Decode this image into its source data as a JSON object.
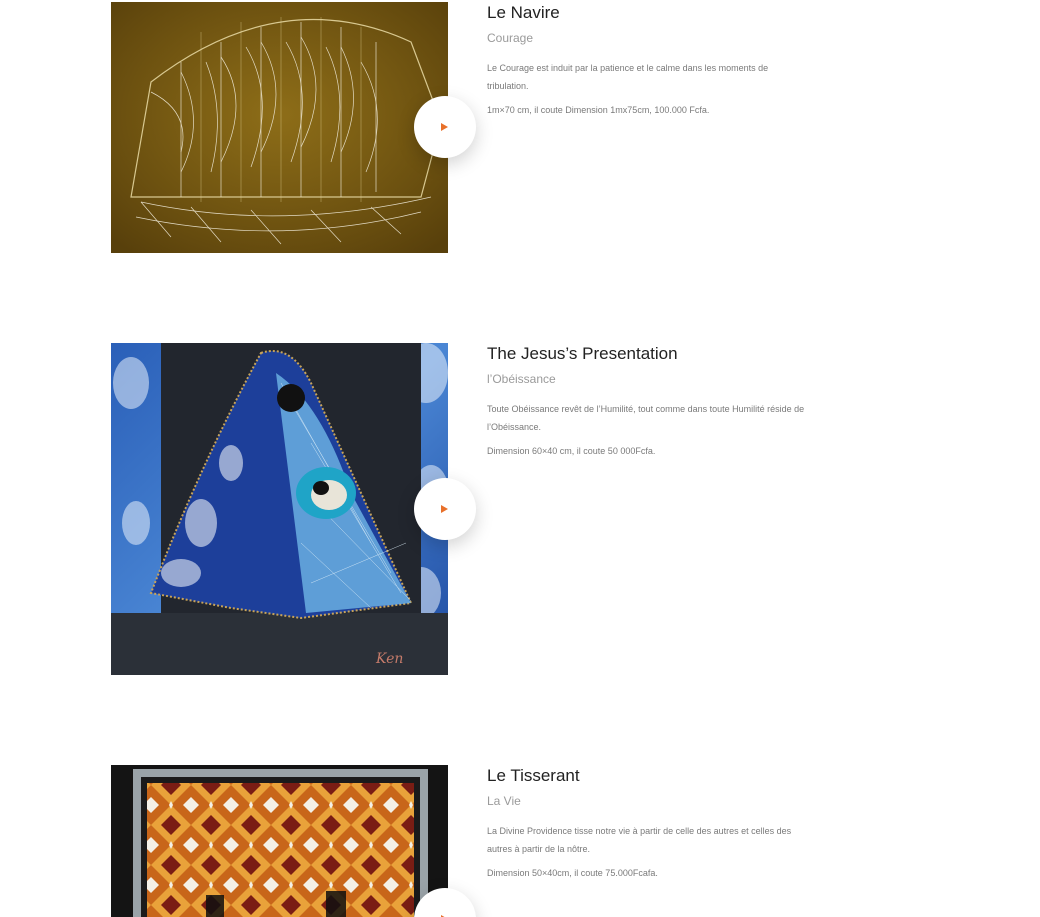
{
  "items": [
    {
      "title": "Le Navire",
      "subtitle": "Courage",
      "description": "Le Courage est induit par la patience et le calme dans les moments de tribulation.",
      "price": "1m×70 cm, il coute Dimension 1mx75cm, 100.000 Fcfa.",
      "play_icon": "play-icon"
    },
    {
      "title": "The Jesus’s Presentation",
      "subtitle": "l’Obéissance",
      "description": "Toute Obéissance revêt de l’Humilité, tout comme dans toute Humilité réside de l’Obéissance.",
      "price": "Dimension 60×40 cm, il coute 50 000Fcfa.",
      "play_icon": "play-icon"
    },
    {
      "title": "Le Tisserant",
      "subtitle": "La Vie",
      "description": "La Divine Providence tisse notre vie à partir de celle des autres et celles des autres à partir de la nôtre.",
      "price": "Dimension 50×40cm, il coute 75.000Fcafa.",
      "play_icon": "play-icon"
    }
  ],
  "colors": {
    "accent": "#e8702a",
    "title": "#222222",
    "subtitle": "#9a9a9a",
    "body": "#7a7a7a"
  }
}
